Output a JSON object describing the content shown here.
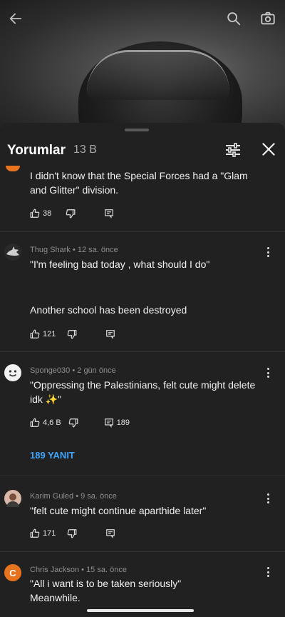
{
  "video": {
    "back_icon": "arrow-left-icon",
    "search_icon": "search-icon",
    "camera_icon": "camera-icon"
  },
  "sheet": {
    "title": "Yorumlar",
    "count": "13 B",
    "filter_icon": "filter-icon",
    "close_icon": "close-icon"
  },
  "comments": [
    {
      "text": "I didn't know that the Special Forces had a \"Glam and Glitter\" division.",
      "likes": "38"
    },
    {
      "author": "Thug Shark",
      "time": "12 sa. önce",
      "text": "\"I'm feeling bad today , what should I do\"",
      "text2": "Another school has been destroyed",
      "likes": "121"
    },
    {
      "author": "Sponge030",
      "time": "2 gün önce",
      "text": "\"Oppressing the Palestinians, felt cute might delete idk ✨\"",
      "likes": "4,6 B",
      "reply_count": "189",
      "replies_label": "189 YANIT"
    },
    {
      "author": "Karim Guled",
      "time": "9 sa. önce",
      "text": "\"felt cute might continue aparthide later\"",
      "likes": "171"
    },
    {
      "author": "Chris Jackson",
      "time": "15 sa. önce",
      "avatar_letter": "C",
      "text": "\"All i want is to be taken seriously\"",
      "text2": "Meanwhile."
    }
  ],
  "colors": {
    "sheet_bg": "#212121",
    "accent_link": "#3ea6ff",
    "avatar_orange": "#e8731f"
  }
}
